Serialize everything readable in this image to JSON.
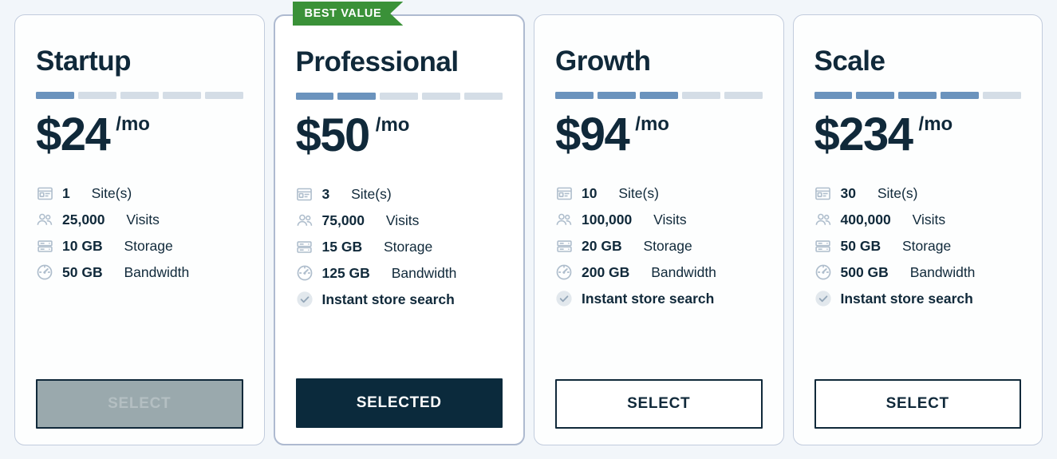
{
  "theme": {
    "page_bg": "#f2f6fa",
    "card_bg": "#fdfefe",
    "card_border": "#c2ccdd",
    "featured_border": "#aebad0",
    "text_dark": "#10293a",
    "segment_on": "#6b93bd",
    "segment_off": "#d4dde6",
    "ribbon_green": "#3a9138",
    "icon_grey": "#aebdcc",
    "button_selected_bg": "#0b2a3c",
    "button_hover_bg": "#9aa9ad"
  },
  "ribbon": {
    "label": "BEST VALUE"
  },
  "tier_segment_count": 5,
  "plans": [
    {
      "name": "Startup",
      "price": "$24",
      "period": "/mo",
      "tier_filled": 1,
      "featured": false,
      "features": [
        {
          "icon": "browser-window-icon",
          "value": "1",
          "label": "Site(s)",
          "bold_label": false
        },
        {
          "icon": "users-group-icon",
          "value": "25,000",
          "label": "Visits",
          "bold_label": false
        },
        {
          "icon": "server-storage-icon",
          "value": "10 GB",
          "label": "Storage",
          "bold_label": false
        },
        {
          "icon": "speedometer-icon",
          "value": "50 GB",
          "label": "Bandwidth",
          "bold_label": false
        }
      ],
      "button": {
        "label": "SELECT",
        "state": "hovered"
      }
    },
    {
      "name": "Professional",
      "price": "$50",
      "period": "/mo",
      "tier_filled": 2,
      "featured": true,
      "features": [
        {
          "icon": "browser-window-icon",
          "value": "3",
          "label": "Site(s)",
          "bold_label": false
        },
        {
          "icon": "users-group-icon",
          "value": "75,000",
          "label": "Visits",
          "bold_label": false
        },
        {
          "icon": "server-storage-icon",
          "value": "15 GB",
          "label": "Storage",
          "bold_label": false
        },
        {
          "icon": "speedometer-icon",
          "value": "125 GB",
          "label": "Bandwidth",
          "bold_label": false
        },
        {
          "icon": "check-circle-icon",
          "value": "",
          "label": "Instant store search",
          "bold_label": true
        }
      ],
      "button": {
        "label": "SELECTED",
        "state": "selected"
      }
    },
    {
      "name": "Growth",
      "price": "$94",
      "period": "/mo",
      "tier_filled": 3,
      "featured": false,
      "features": [
        {
          "icon": "browser-window-icon",
          "value": "10",
          "label": "Site(s)",
          "bold_label": false
        },
        {
          "icon": "users-group-icon",
          "value": "100,000",
          "label": "Visits",
          "bold_label": false
        },
        {
          "icon": "server-storage-icon",
          "value": "20 GB",
          "label": "Storage",
          "bold_label": false
        },
        {
          "icon": "speedometer-icon",
          "value": "200 GB",
          "label": "Bandwidth",
          "bold_label": false
        },
        {
          "icon": "check-circle-icon",
          "value": "",
          "label": "Instant store search",
          "bold_label": true
        }
      ],
      "button": {
        "label": "SELECT",
        "state": "outline"
      }
    },
    {
      "name": "Scale",
      "price": "$234",
      "period": "/mo",
      "tier_filled": 4,
      "featured": false,
      "features": [
        {
          "icon": "browser-window-icon",
          "value": "30",
          "label": "Site(s)",
          "bold_label": false
        },
        {
          "icon": "users-group-icon",
          "value": "400,000",
          "label": "Visits",
          "bold_label": false
        },
        {
          "icon": "server-storage-icon",
          "value": "50 GB",
          "label": "Storage",
          "bold_label": false
        },
        {
          "icon": "speedometer-icon",
          "value": "500 GB",
          "label": "Bandwidth",
          "bold_label": false
        },
        {
          "icon": "check-circle-icon",
          "value": "",
          "label": "Instant store search",
          "bold_label": true
        }
      ],
      "button": {
        "label": "SELECT",
        "state": "outline"
      }
    }
  ]
}
